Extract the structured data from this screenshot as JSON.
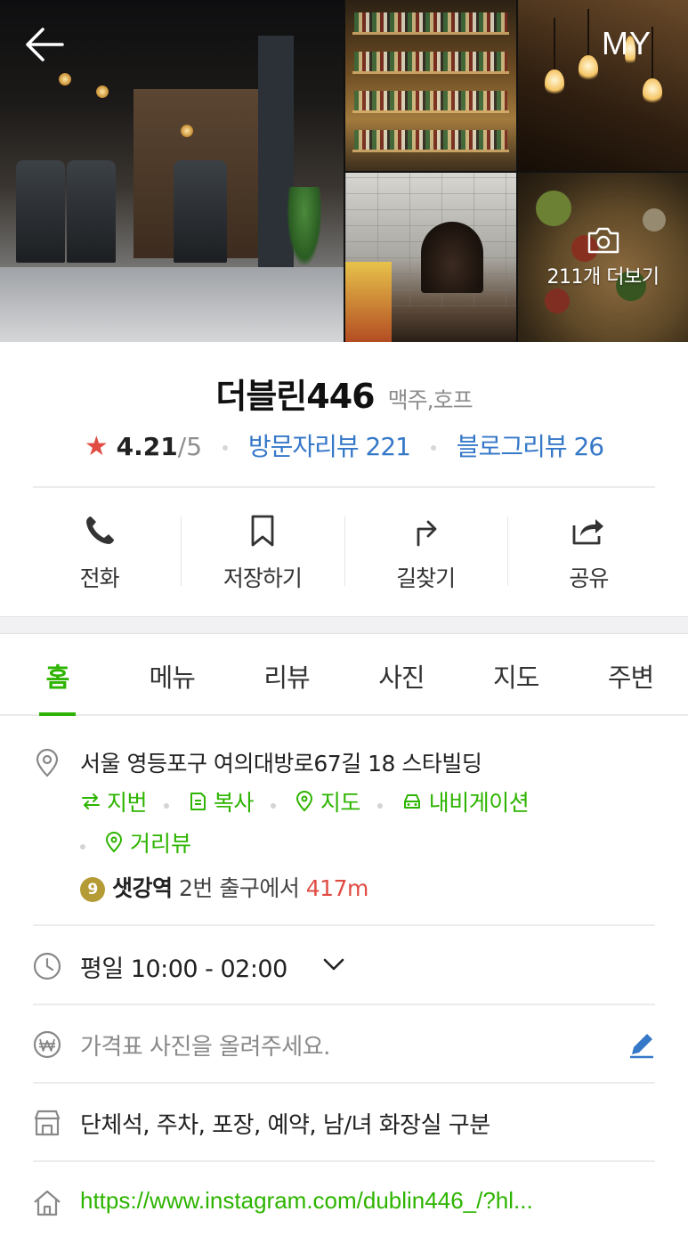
{
  "header": {
    "back_icon": "arrow-left-icon",
    "my_label": "MY",
    "more_photos_label": "211개 더보기",
    "camera_icon": "camera-icon"
  },
  "place": {
    "name": "더블린446",
    "category": "맥주,호프",
    "rating_star": "★",
    "rating": "4.21",
    "rating_max": "/5",
    "visitor_reviews": "방문자리뷰 221",
    "blog_reviews": "블로그리뷰 26"
  },
  "actions": [
    {
      "label": "전화",
      "icon": "phone-icon"
    },
    {
      "label": "저장하기",
      "icon": "bookmark-icon"
    },
    {
      "label": "길찾기",
      "icon": "directions-icon"
    },
    {
      "label": "공유",
      "icon": "share-icon"
    }
  ],
  "tabs": [
    {
      "label": "홈",
      "active": true
    },
    {
      "label": "메뉴"
    },
    {
      "label": "리뷰"
    },
    {
      "label": "사진"
    },
    {
      "label": "지도"
    },
    {
      "label": "주변"
    }
  ],
  "info": {
    "address": "서울 영등포구 여의대방로67길 18 스타빌딩",
    "address_actions": [
      "지번",
      "복사",
      "지도",
      "내비게이션"
    ],
    "street_view": "거리뷰",
    "subway_line": "9",
    "station_name": "샛강역",
    "station_exit": " 2번 출구에서 ",
    "station_distance": "417m",
    "hours": "평일 10:00 - 02:00",
    "price_prompt": "가격표 사진을 올려주세요.",
    "facilities": "단체석, 주차, 포장, 예약, 남/녀 화장실 구분",
    "homepage": "https://www.instagram.com/dublin446_/?hl..."
  },
  "colors": {
    "accent_green": "#2db400",
    "link_blue": "#3678c8",
    "star_red": "#e04c43",
    "line9_badge": "#b59b35"
  }
}
